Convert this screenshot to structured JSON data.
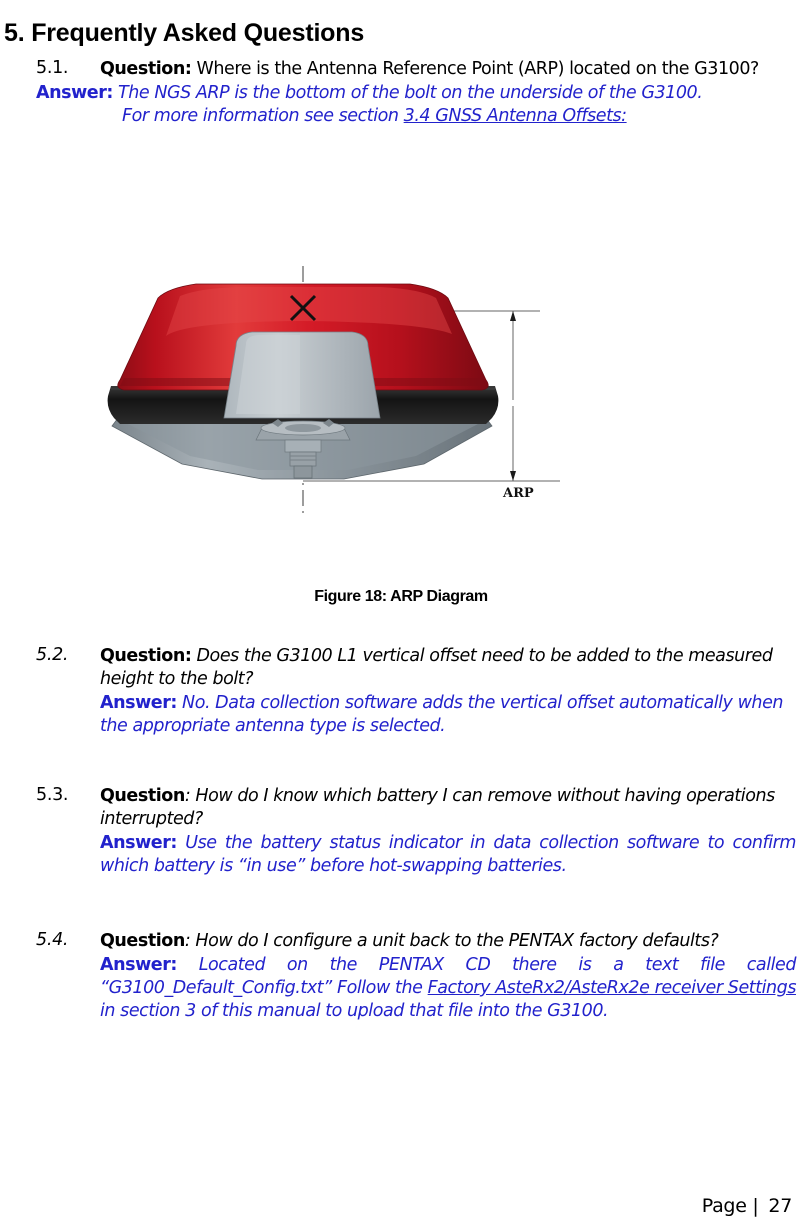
{
  "document": {
    "heading": "5. Frequently Asked Questions",
    "figure_caption": "Figure 18: ARP Diagram",
    "footer": {
      "label": "Page |",
      "page_number": "27"
    }
  },
  "faq": {
    "items": [
      {
        "number": "5.1.",
        "question_label": "Question:",
        "question_text": " Where is the Antenna Reference Point (ARP) located on the G3100?",
        "answer_label": "Answer:",
        "answer_text": " The NGS ARP is the bottom of the bolt on the underside of the G3100.",
        "answer_extra_prefix": "For more information see section ",
        "answer_link": "3.4 GNSS Antenna Offsets:"
      },
      {
        "number": "5.2.",
        "question_label": "Question:",
        "question_text": " Does the G3100 L1 vertical offset need to be added to the measured height to the bolt?",
        "answer_label": "Answer:",
        "answer_text": " No.  Data collection software adds the vertical offset automatically when the appropriate antenna type is selected."
      },
      {
        "number": "5.3.",
        "question_label": "Question",
        "question_text": ": How do I know which battery I can remove without having operations interrupted?",
        "answer_label": "Answer:",
        "answer_text": "  Use the battery status indicator in data collection software to confirm which battery is “in use” before hot-swapping batteries."
      },
      {
        "number": "5.4.",
        "question_label": "Question",
        "question_text": ": How do I configure a unit back to the PENTAX factory defaults?",
        "answer_label": "Answer:",
        "answer_text_1": "  Located on the PENTAX CD there is a text file called “G3100_Default_Config.txt” Follow the ",
        "answer_link": "Factory AsteRx2/AsteRx2e receiver Settings",
        "answer_text_2": " in section 3 of this manual to upload that file into the G3100."
      }
    ]
  },
  "figure": {
    "name": "arp-diagram",
    "alt": "GNSS antenna cross-section showing Antenna Reference Point",
    "arp_label": "ARP",
    "phase_center_marker": "X",
    "colors": {
      "dome_red": "#c8121f",
      "dome_red_light": "#e03a3a",
      "dome_red_dark": "#8b0d17",
      "band_black": "#1c1c1c",
      "base_grey": "#9aa3a9",
      "base_grey_light": "#c3c9cd",
      "base_grey_dark": "#6d777e",
      "dimension_line": "#555555",
      "link_blue": "#2222cc"
    }
  }
}
